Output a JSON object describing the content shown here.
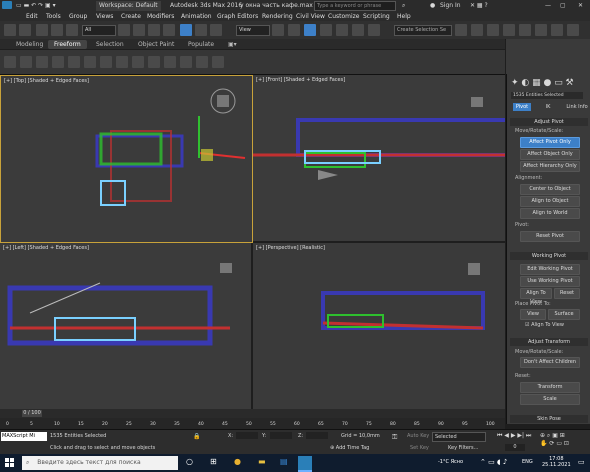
{
  "titlebar": {
    "workspace": "Workspace: Default",
    "app_title": "Autodesk 3ds Max 2016",
    "file_name": "у окна часть кафе.max",
    "search_placeholder": "Type a keyword or phrase",
    "sign_in": "Sign In"
  },
  "menu": [
    "Edit",
    "Tools",
    "Group",
    "Views",
    "Create",
    "Modifiers",
    "Animation",
    "Graph Editors",
    "Rendering",
    "Civil View",
    "Customize",
    "Scripting",
    "Help"
  ],
  "toolbar": {
    "selection_filter": "All",
    "ref_coord": "View",
    "named_selection": "Create Selection Se"
  },
  "ribbon_tabs": [
    "Modeling",
    "Freeform",
    "Selection",
    "Object Paint",
    "Populate"
  ],
  "ribbon_active": "Freeform",
  "viewports": {
    "top": "[+] [Top] [Shaded + Edged Faces]",
    "front": "[+] [Front] [Shaded + Edged Faces]",
    "left": "[+] [Left] [Shaded + Edged Faces]",
    "perspective": "[+] [Perspective] [Realistic]"
  },
  "command_panel": {
    "entity_count": "1535 Entities Selected",
    "tabs": [
      "Pivot",
      "IK",
      "Link Info"
    ],
    "adjust_pivot": "Adjust Pivot",
    "move_rotate_scale": "Move/Rotate/Scale:",
    "affect_pivot_only": "Affect Pivot Only",
    "affect_object_only": "Affect Object Only",
    "affect_hierarchy_only": "Affect Hierarchy Only",
    "alignment": "Alignment:",
    "center_to_object": "Center to Object",
    "align_to_object": "Align to Object",
    "align_to_world": "Align to World",
    "pivot": "Pivot:",
    "reset_pivot": "Reset Pivot",
    "working_pivot": "Working Pivot",
    "edit_working_pivot": "Edit Working Pivot",
    "use_working_pivot": "Use Working Pivot",
    "align_to_view": "Align To View",
    "reset": "Reset",
    "place_pivot_to": "Place Pivot To:",
    "view": "View",
    "surface": "Surface",
    "align_to_view_check": "Align To View",
    "adjust_transform": "Adjust Transform",
    "move_rotate_scale2": "Move/Rotate/Scale:",
    "dont_affect_children": "Don't Affect Children",
    "reset_label": "Reset:",
    "transform": "Transform",
    "scale": "Scale",
    "skin_pose": "Skin Pose"
  },
  "timeline": {
    "frame": "0 / 100",
    "ticks": [
      "0",
      "5",
      "10",
      "15",
      "20",
      "25",
      "30",
      "35",
      "40",
      "45",
      "50",
      "55",
      "60",
      "65",
      "70",
      "75",
      "80",
      "85",
      "90",
      "95",
      "100"
    ]
  },
  "status": {
    "maxscript": "MAXScript Mi",
    "selected": "1535 Entities Selected",
    "hint": "Click and drag to select and move objects",
    "x_label": "X:",
    "y_label": "Y:",
    "z_label": "Z:",
    "grid": "Grid = 10,0mm",
    "add_time_tag": "Add Time Tag",
    "auto_key": "Auto Key",
    "set_key": "Set Key",
    "selected_dropdown": "Selected",
    "key_filters": "Key Filters...",
    "frame_value": "0"
  },
  "taskbar": {
    "search": "Введите здесь текст для поиска",
    "temp": "-1°C Ясно",
    "lang": "ENG",
    "time": "17:08",
    "date": "25.11.2021"
  }
}
